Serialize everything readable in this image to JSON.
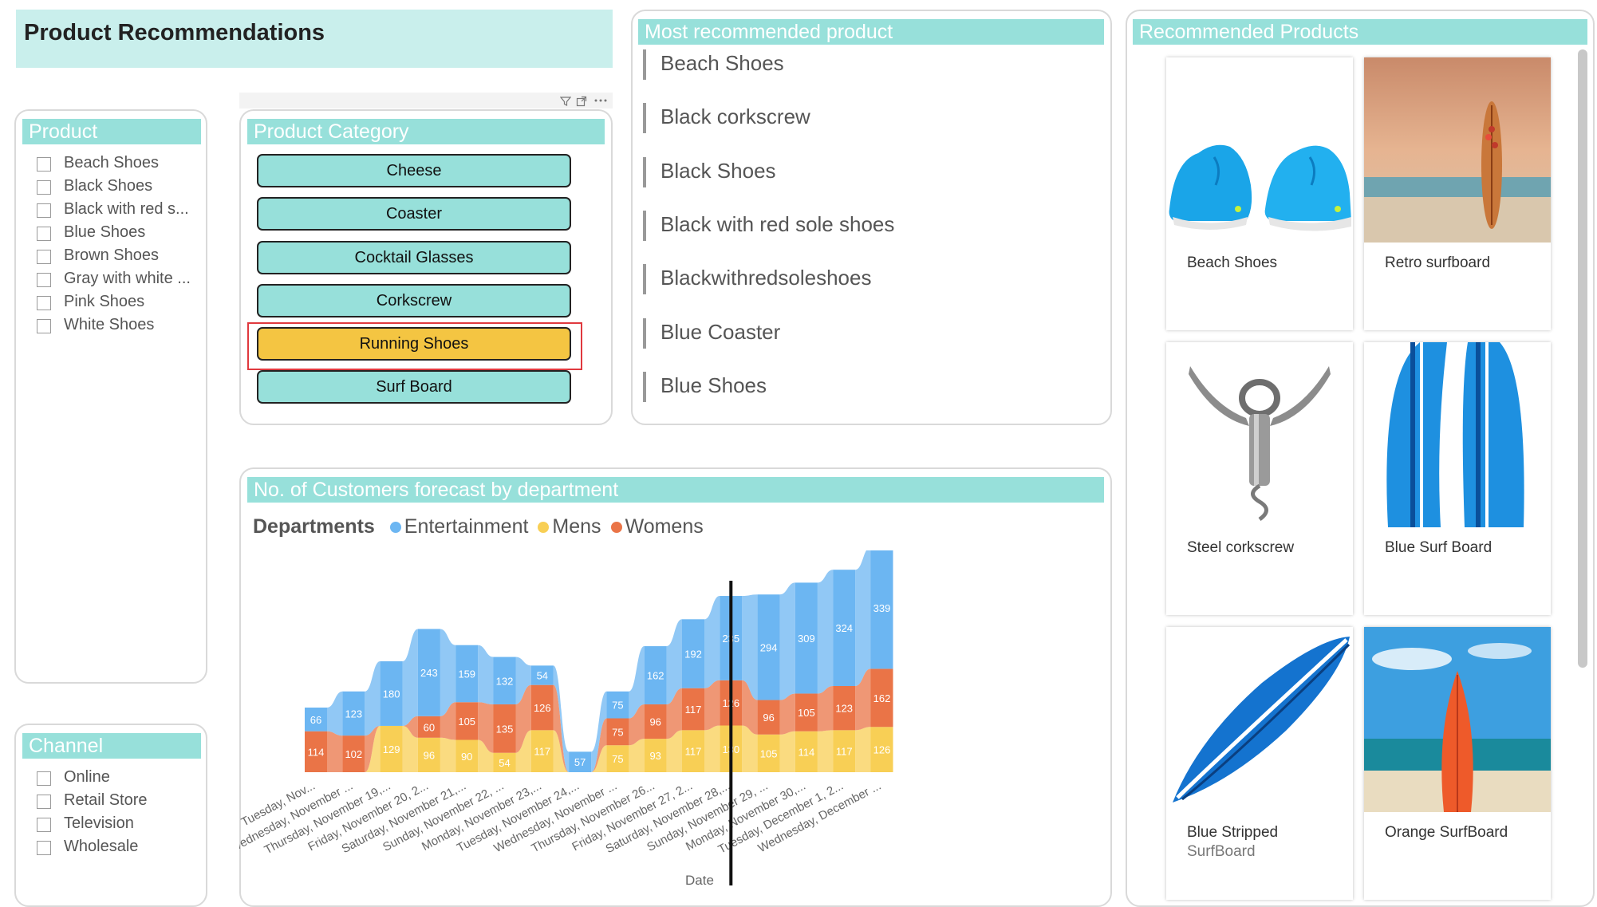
{
  "page": {
    "title": "Product Recommendations"
  },
  "product_filter": {
    "header": "Product",
    "items": [
      "Beach Shoes",
      "Black Shoes",
      "Black with red s...",
      "Blue Shoes",
      "Brown Shoes",
      "Gray with white ...",
      "Pink Shoes",
      "White Shoes"
    ]
  },
  "channel_filter": {
    "header": "Channel",
    "items": [
      "Online",
      "Retail Store",
      "Television",
      "Wholesale"
    ]
  },
  "category": {
    "header": "Product Category",
    "buttons": [
      "Cheese",
      "Coaster",
      "Cocktail Glasses",
      "Corkscrew",
      "Running Shoes",
      "Surf Board"
    ],
    "selected": "Running Shoes"
  },
  "most_recommended": {
    "header": "Most recommended product",
    "items": [
      "Beach Shoes",
      "Black corkscrew",
      "Black Shoes",
      "Black with red sole shoes",
      "Blackwithredsoleshoes",
      "Blue Coaster",
      "Blue Shoes"
    ]
  },
  "recommended_products": {
    "header": "Recommended Products",
    "tiles": [
      {
        "name": "Beach Shoes",
        "sub": ""
      },
      {
        "name": "Retro surfboard",
        "sub": ""
      },
      {
        "name": "Steel corkscrew",
        "sub": ""
      },
      {
        "name": "Blue Surf Board",
        "sub": ""
      },
      {
        "name": "Blue Stripped",
        "sub": "SurfBoard"
      },
      {
        "name": "Orange SurfBoard",
        "sub": ""
      }
    ]
  },
  "forecast": {
    "header": "No. of Customers forecast by department",
    "legend_title": "Departments",
    "xlabel": "Date"
  },
  "colors": {
    "entertainment": "#6cb6f2",
    "mens": "#f8cf55",
    "womens": "#ea7447",
    "header": "#97e0da",
    "selected": "#f4c542"
  },
  "chart_data": {
    "type": "area",
    "title": "No. of Customers forecast by department",
    "xlabel": "Date",
    "ylabel": "",
    "categories": [
      "Tuesday, Nov...",
      "Wednesday, November ...",
      "Thursday, November 19,...",
      "Friday, November 20, 2...",
      "Saturday, November 21,...",
      "Sunday, November 22, ...",
      "Monday, November 23,...",
      "Tuesday, November 24,...",
      "Wednesday, November ...",
      "Thursday, November 26...",
      "Friday, November 27, 2...",
      "Saturday, November 28,...",
      "Sunday, November 29, ...",
      "Monday, November 30,...",
      "Tuesday, December 1, 2...",
      "Wednesday, December ..."
    ],
    "series": [
      {
        "name": "Entertainment",
        "values": [
          66,
          123,
          180,
          243,
          159,
          132,
          54,
          57,
          75,
          162,
          192,
          235,
          294,
          309,
          324,
          339
        ]
      },
      {
        "name": "Mens",
        "values": [
          null,
          null,
          129,
          96,
          90,
          54,
          117,
          null,
          75,
          93,
          117,
          130,
          105,
          114,
          117,
          126
        ]
      },
      {
        "name": "Womens",
        "values": [
          114,
          102,
          null,
          60,
          105,
          135,
          126,
          null,
          75,
          96,
          117,
          126,
          96,
          105,
          123,
          162
        ]
      }
    ],
    "legend": "top-left",
    "grid": false
  }
}
